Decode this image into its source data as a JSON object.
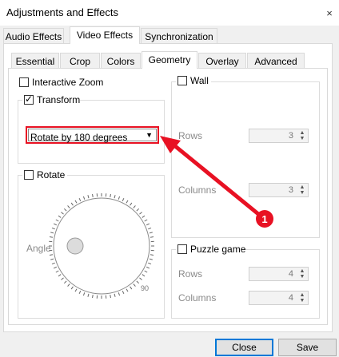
{
  "window": {
    "title": "Adjustments and Effects",
    "close_glyph": "×"
  },
  "main_tabs": [
    {
      "label": "Audio Effects"
    },
    {
      "label": "Video Effects"
    },
    {
      "label": "Synchronization"
    }
  ],
  "sub_tabs": [
    {
      "label": "Essential"
    },
    {
      "label": "Crop"
    },
    {
      "label": "Colors"
    },
    {
      "label": "Geometry"
    },
    {
      "label": "Overlay"
    },
    {
      "label": "Advanced"
    }
  ],
  "geometry": {
    "interactive_zoom": {
      "label": "Interactive Zoom",
      "checked": false
    },
    "transform": {
      "label": "Transform",
      "checked": true,
      "selected": "Rotate by 180 degrees"
    },
    "rotate": {
      "label": "Rotate",
      "checked": false,
      "angle_label": "Angle",
      "dial_value": "90"
    },
    "wall": {
      "label": "Wall",
      "checked": false,
      "rows_label": "Rows",
      "rows_value": "3",
      "columns_label": "Columns",
      "columns_value": "3"
    },
    "puzzle": {
      "label": "Puzzle game",
      "checked": false,
      "rows_label": "Rows",
      "rows_value": "4",
      "columns_label": "Columns",
      "columns_value": "4"
    }
  },
  "annotation": {
    "badge": "1",
    "color": "#e81123"
  },
  "footer": {
    "close_label": "Close",
    "save_label": "Save"
  }
}
